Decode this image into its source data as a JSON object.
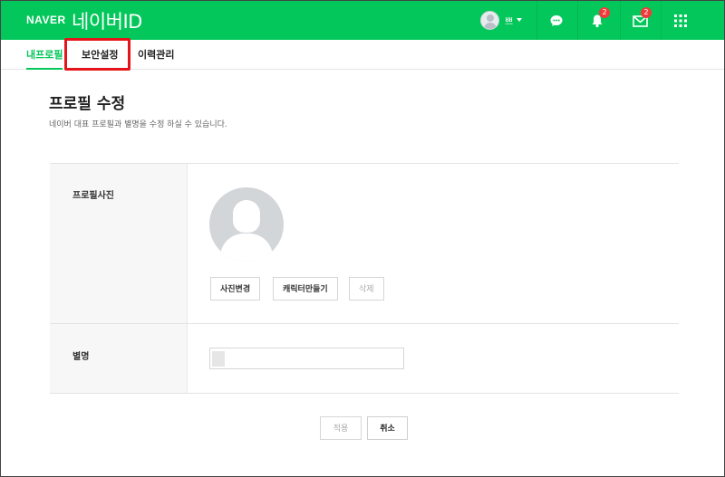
{
  "header": {
    "brand": "NAVER",
    "service": "네이버ID",
    "user_name": "쁘",
    "notification_badge": "2",
    "mail_badge": "2",
    "accent_color": "#03c75a",
    "icons": [
      "user-avatar",
      "chat-icon",
      "bell-icon",
      "mail-icon",
      "grid-icon"
    ]
  },
  "tabs": [
    {
      "label": "내프로필",
      "active": true
    },
    {
      "label": "보안설정",
      "active": false,
      "highlighted": true
    },
    {
      "label": "이력관리",
      "active": false
    }
  ],
  "page": {
    "title": "프로필 수정",
    "description": "네이버 대표 프로필과 별명을 수정 하실 수 있습니다."
  },
  "form": {
    "photo_label": "프로필사진",
    "change_photo_button": "사진변경",
    "make_character_button": "캐릭터만들기",
    "delete_button": "삭제",
    "nickname_label": "별명",
    "nickname_value": ""
  },
  "actions": {
    "apply": "적용",
    "cancel": "취소"
  }
}
